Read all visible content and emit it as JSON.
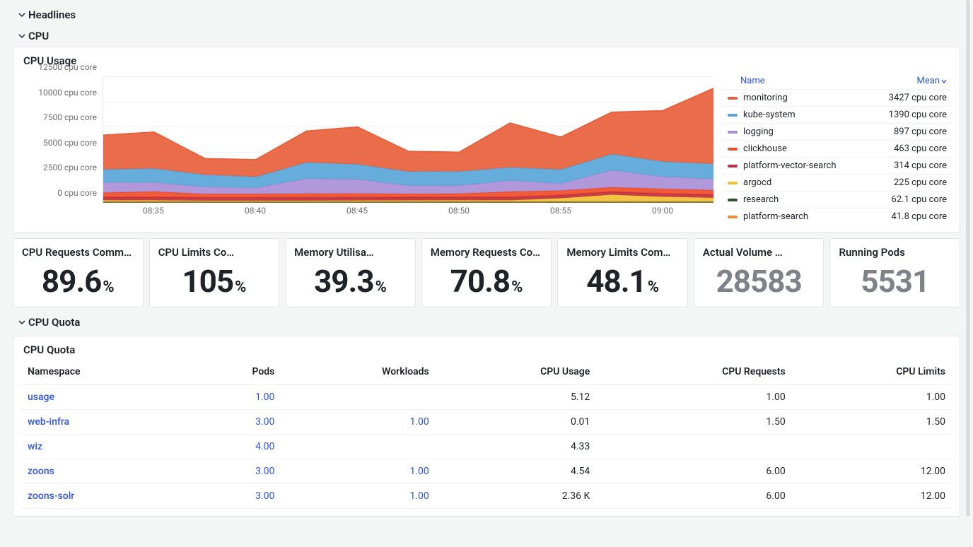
{
  "sections": {
    "headlines": "Headlines",
    "cpu": "CPU",
    "cpu_quota": "CPU Quota"
  },
  "cpu_usage": {
    "title": "CPU Usage",
    "legend_headers": {
      "name": "Name",
      "mean": "Mean"
    },
    "legend": [
      {
        "name": "monitoring",
        "mean": "3427 cpu core",
        "color": "#e8613c"
      },
      {
        "name": "kube-system",
        "mean": "1390 cpu core",
        "color": "#5aa6d8"
      },
      {
        "name": "logging",
        "mean": "897 cpu core",
        "color": "#a98fd8"
      },
      {
        "name": "clickhouse",
        "mean": "463 cpu core",
        "color": "#ef4d28"
      },
      {
        "name": "platform-vector-search",
        "mean": "314 cpu core",
        "color": "#c12f3e"
      },
      {
        "name": "argocd",
        "mean": "225 cpu core",
        "color": "#f2c037"
      },
      {
        "name": "research",
        "mean": "62.1 cpu core",
        "color": "#2e5235"
      },
      {
        "name": "platform-search",
        "mean": "41.8 cpu core",
        "color": "#f28d2c"
      }
    ]
  },
  "chart_data": {
    "type": "area",
    "title": "CPU Usage",
    "xlabel": "",
    "ylabel": "cpu core",
    "ylim": [
      0,
      12500
    ],
    "x": [
      "08:32",
      "08:35",
      "08:38",
      "08:40",
      "08:42",
      "08:45",
      "08:48",
      "08:50",
      "08:52",
      "08:55",
      "08:58",
      "09:00",
      "09:03"
    ],
    "y_ticks": [
      "0 cpu core",
      "2500 cpu core",
      "5000 cpu core",
      "7500 cpu core",
      "10000 cpu core",
      "12500 cpu core"
    ],
    "x_ticks": [
      "08:35",
      "08:40",
      "08:45",
      "08:50",
      "08:55",
      "09:00"
    ],
    "series": [
      {
        "name": "platform-search",
        "color": "#f28d2c",
        "values": [
          42,
          42,
          42,
          42,
          42,
          42,
          42,
          42,
          42,
          42,
          42,
          42,
          42
        ]
      },
      {
        "name": "research",
        "color": "#2e5235",
        "values": [
          62,
          62,
          62,
          62,
          62,
          62,
          62,
          62,
          62,
          62,
          62,
          62,
          62
        ]
      },
      {
        "name": "argocd",
        "color": "#f2c037",
        "values": [
          150,
          150,
          120,
          120,
          120,
          130,
          140,
          150,
          150,
          350,
          700,
          500,
          400
        ]
      },
      {
        "name": "platform-vector-search",
        "color": "#c12f3e",
        "values": [
          314,
          314,
          314,
          314,
          314,
          314,
          314,
          314,
          314,
          314,
          314,
          314,
          314
        ]
      },
      {
        "name": "clickhouse",
        "color": "#ef4d28",
        "values": [
          450,
          550,
          350,
          350,
          380,
          380,
          350,
          350,
          550,
          450,
          430,
          480,
          450
        ]
      },
      {
        "name": "logging",
        "color": "#a98fd8",
        "values": [
          1000,
          900,
          700,
          600,
          1500,
          1400,
          800,
          800,
          1100,
          700,
          1700,
          1200,
          1100
        ]
      },
      {
        "name": "kube-system",
        "color": "#5aa6d8",
        "values": [
          1300,
          1400,
          1200,
          1100,
          1600,
          1500,
          1400,
          1400,
          1300,
          1400,
          1600,
          1500,
          1500
        ]
      },
      {
        "name": "monitoring",
        "color": "#e8613c",
        "values": [
          3400,
          3600,
          1600,
          1700,
          3100,
          3700,
          2000,
          1900,
          4400,
          3200,
          4150,
          5050,
          7500
        ]
      }
    ]
  },
  "stats": [
    {
      "label": "CPU Requests Commit…",
      "value": "89.6",
      "unit": "%",
      "grey": false
    },
    {
      "label": "CPU Limits Co…",
      "value": "105",
      "unit": "%",
      "grey": false
    },
    {
      "label": "Memory Utilisa…",
      "value": "39.3",
      "unit": "%",
      "grey": false
    },
    {
      "label": "Memory Requests Com…",
      "value": "70.8",
      "unit": "%",
      "grey": false
    },
    {
      "label": "Memory Limits Commit…",
      "value": "48.1",
      "unit": "%",
      "grey": false
    },
    {
      "label": "Actual Volume …",
      "value": "28583",
      "unit": "",
      "grey": true
    },
    {
      "label": "Running Pods",
      "value": "5531",
      "unit": "",
      "grey": true
    }
  ],
  "quota": {
    "title": "CPU Quota",
    "columns": [
      "Namespace",
      "Pods",
      "Workloads",
      "CPU Usage",
      "CPU Requests",
      "CPU Limits"
    ],
    "rows": [
      {
        "ns": "usage",
        "pods": "1.00",
        "workloads": "",
        "usage": "5.12",
        "req": "1.00",
        "lim": "1.00"
      },
      {
        "ns": "web-infra",
        "pods": "3.00",
        "workloads": "1.00",
        "usage": "0.01",
        "req": "1.50",
        "lim": "1.50"
      },
      {
        "ns": "wiz",
        "pods": "4.00",
        "workloads": "",
        "usage": "4.33",
        "req": "",
        "lim": ""
      },
      {
        "ns": "zoons",
        "pods": "3.00",
        "workloads": "1.00",
        "usage": "4.54",
        "req": "6.00",
        "lim": "12.00"
      },
      {
        "ns": "zoons-solr",
        "pods": "3.00",
        "workloads": "1.00",
        "usage": "2.36 K",
        "req": "6.00",
        "lim": "12.00"
      }
    ]
  }
}
